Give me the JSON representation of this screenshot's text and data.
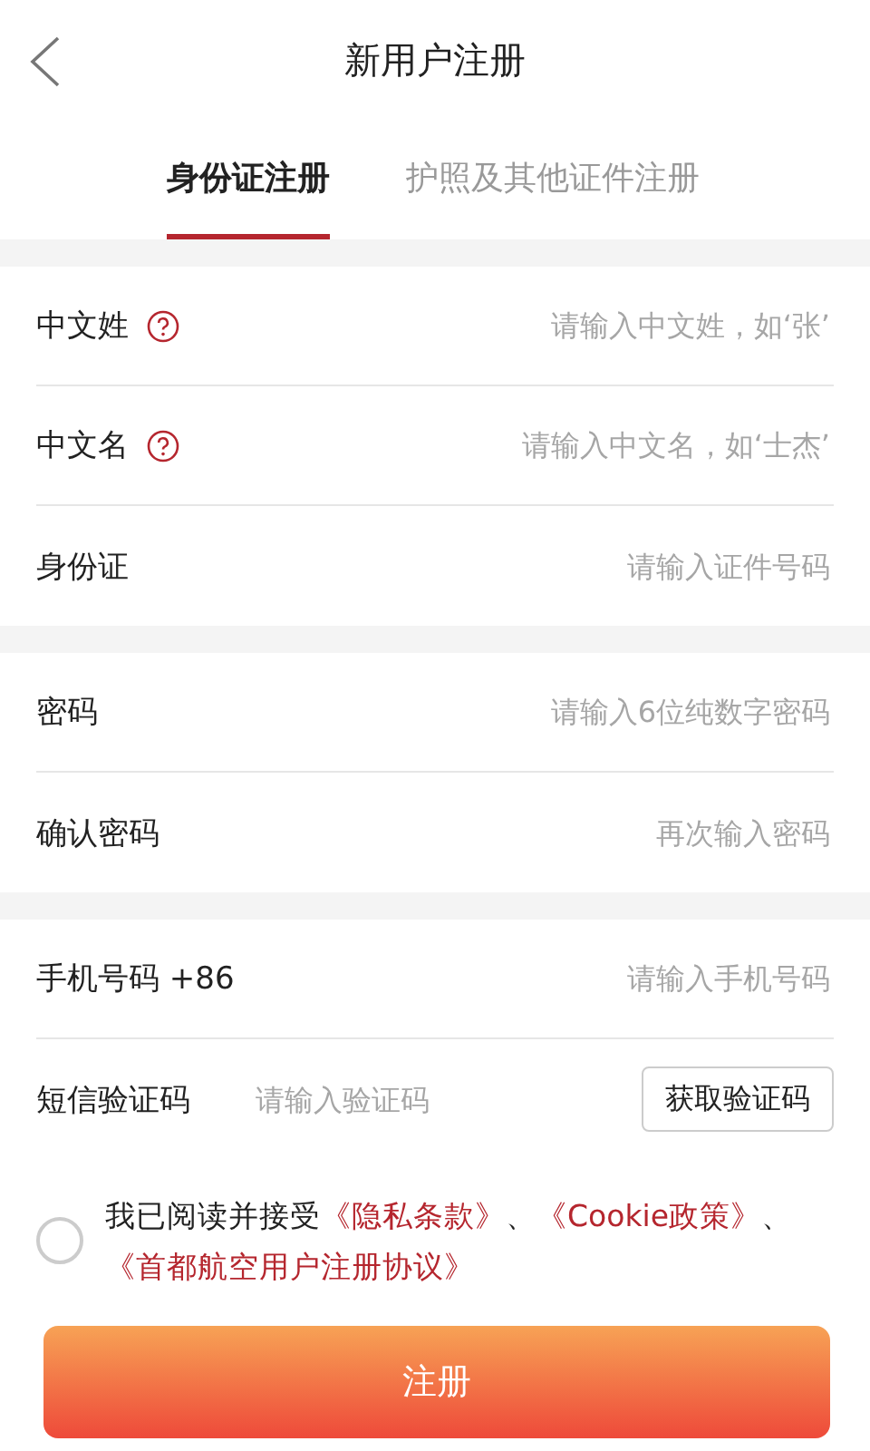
{
  "header": {
    "title": "新用户注册"
  },
  "tabs": [
    {
      "label": "身份证注册",
      "selected": true
    },
    {
      "label": "护照及其他证件注册",
      "selected": false
    }
  ],
  "groups": [
    {
      "fields": [
        {
          "kind": "input",
          "label": "中文姓",
          "help": true,
          "placeholder": "请输入中文姓，如‘张’"
        },
        {
          "kind": "input",
          "label": "中文名",
          "help": true,
          "placeholder": "请输入中文名，如‘士杰’"
        },
        {
          "kind": "input",
          "label": "身份证",
          "help": false,
          "placeholder": "请输入证件号码"
        }
      ]
    },
    {
      "fields": [
        {
          "kind": "input",
          "label": "密码",
          "help": false,
          "placeholder": "请输入6位纯数字密码"
        },
        {
          "kind": "input",
          "label": "确认密码",
          "help": false,
          "placeholder": "再次输入密码"
        }
      ]
    },
    {
      "fields": [
        {
          "kind": "input",
          "label": "手机号码 +86",
          "help": false,
          "placeholder": "请输入手机号码"
        },
        {
          "kind": "code",
          "label": "短信验证码",
          "placeholder": "请输入验证码",
          "button": "获取验证码"
        }
      ]
    }
  ],
  "agreement": {
    "checked": false,
    "parts": [
      {
        "kind": "text",
        "text": "我已阅读并接受"
      },
      {
        "kind": "link",
        "text": "《隐私条款》"
      },
      {
        "kind": "text",
        "text": "、"
      },
      {
        "kind": "link",
        "text": "《Cookie政策》"
      },
      {
        "kind": "text",
        "text": "、"
      },
      {
        "kind": "link",
        "text": "《首都航空用户注册协议》"
      }
    ]
  },
  "submit": "注册"
}
